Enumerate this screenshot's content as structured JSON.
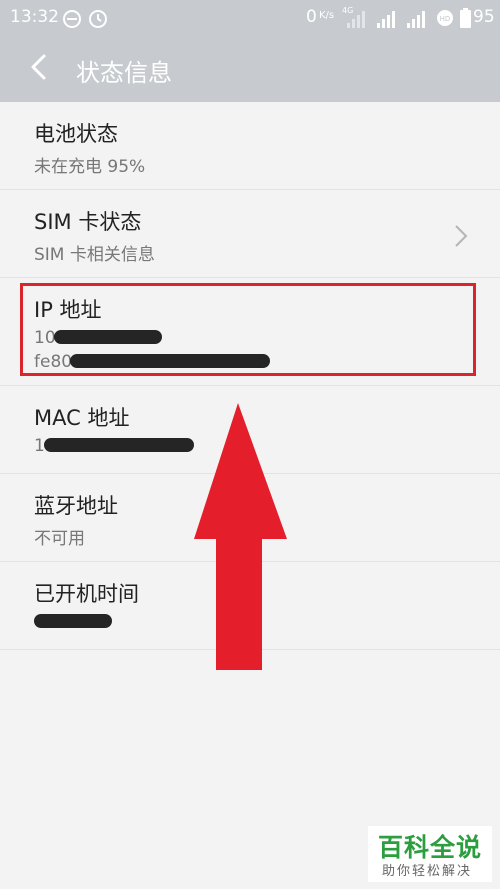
{
  "status_bar": {
    "time": "13:32",
    "network_speed": "0",
    "network_speed_unit": "K/s",
    "signal_tag": "4G",
    "battery": "95"
  },
  "app_bar": {
    "title": "状态信息"
  },
  "items": [
    {
      "title": "电池状态",
      "subtitle": "未在充电 95%"
    },
    {
      "title": "SIM 卡状态",
      "subtitle": "SIM 卡相关信息"
    },
    {
      "title": "IP 地址",
      "subtitle": "10.",
      "subtitle2": "fe80"
    },
    {
      "title": "MAC 地址",
      "subtitle": "1"
    },
    {
      "title": "蓝牙地址",
      "subtitle": "不可用"
    },
    {
      "title": "已开机时间",
      "subtitle": ""
    }
  ],
  "watermark": {
    "title": "百科全说",
    "tagline": "助你轻松解决"
  },
  "colors": {
    "bar": "#c7cbcf",
    "highlight": "#d9252c",
    "arrow": "#e41f2b",
    "brand_green": "#2c9e3f"
  }
}
